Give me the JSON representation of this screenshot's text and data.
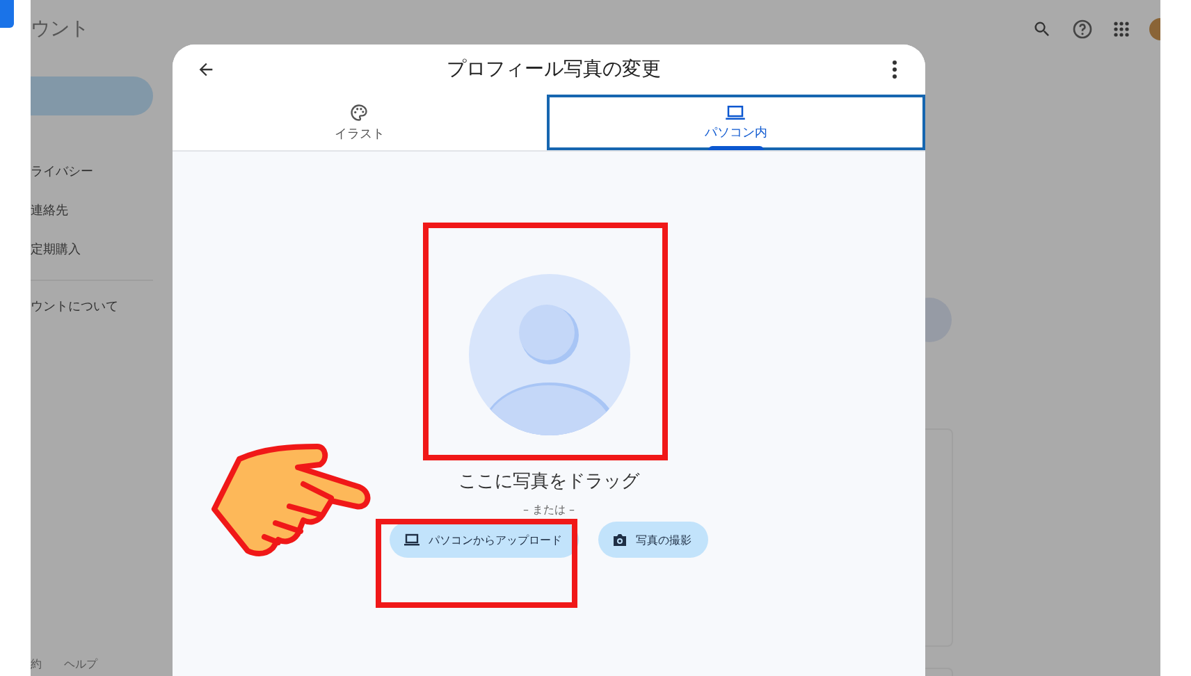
{
  "background_page": {
    "app_title": "ウント",
    "sidebar": {
      "items": [
        "ライバシー",
        "連絡先",
        "定期購入",
        "ウントについて"
      ]
    },
    "footer_links": [
      "約",
      "ヘルプ"
    ]
  },
  "dialog": {
    "title": "プロフィール写真の変更",
    "tabs": [
      {
        "label": "イラスト",
        "kind": "palette",
        "selected": false
      },
      {
        "label": "パソコン内",
        "kind": "laptop",
        "selected": true
      }
    ],
    "drop_hint": "ここに写真をドラッグ",
    "or_divider": "– または –",
    "buttons": [
      {
        "label": "パソコンからアップロード",
        "kind": "upload"
      },
      {
        "label": "写真の撮影",
        "kind": "camera"
      }
    ]
  }
}
